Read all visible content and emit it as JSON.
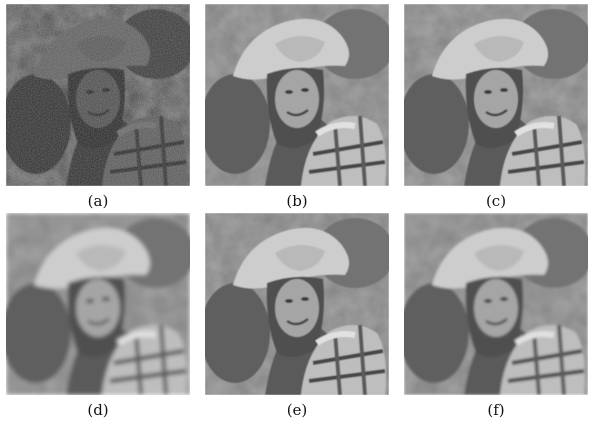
{
  "panels": [
    {
      "id": "a",
      "caption": "(a)",
      "variant": "noisy",
      "subject": "portrait of a woman in a wide-brimmed hat holding a checked cloth"
    },
    {
      "id": "b",
      "caption": "(b)",
      "variant": "denoised-piecewise",
      "subject": "portrait of a woman in a wide-brimmed hat holding a checked cloth"
    },
    {
      "id": "c",
      "caption": "(c)",
      "variant": "denoised-piecewise",
      "subject": "portrait of a woman in a wide-brimmed hat holding a checked cloth"
    },
    {
      "id": "d",
      "caption": "(d)",
      "variant": "denoised-blurred",
      "subject": "portrait of a woman in a wide-brimmed hat holding a checked cloth"
    },
    {
      "id": "e",
      "caption": "(e)",
      "variant": "denoised-piecewise",
      "subject": "portrait of a woman in a wide-brimmed hat holding a checked cloth"
    },
    {
      "id": "f",
      "caption": "(f)",
      "variant": "denoised-smooth",
      "subject": "portrait of a woman in a wide-brimmed hat holding a checked cloth"
    }
  ],
  "colors": {
    "background": "#ffffff",
    "caption_text": "#111111",
    "noisy_base": "#3a3a3a"
  }
}
